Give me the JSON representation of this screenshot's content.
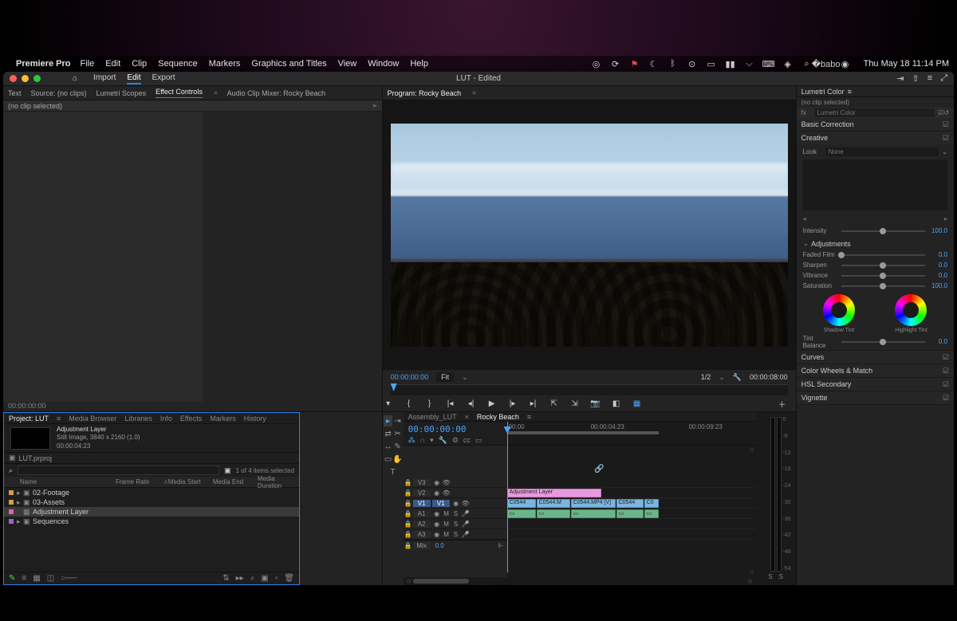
{
  "menubar": {
    "app": "Premiere Pro",
    "items": [
      "File",
      "Edit",
      "Clip",
      "Sequence",
      "Markers",
      "Graphics and Titles",
      "View",
      "Window",
      "Help"
    ],
    "datetime": "Thu May 18  11:14 PM"
  },
  "titlebar": {
    "modes": {
      "import": "Import",
      "edit": "Edit",
      "export": "Export"
    },
    "title": "LUT - Edited"
  },
  "source_tabs": {
    "text": "Text",
    "source": "Source: (no clips)",
    "lumetri_scopes": "Lumetri Scopes",
    "effect_controls": "Effect Controls",
    "audio_mixer": "Audio Clip Mixer: Rocky Beach"
  },
  "effect_controls": {
    "no_clip": "(no clip selected)",
    "timecode": "00:00:00:00"
  },
  "program": {
    "tab": "Program: Rocky Beach",
    "timecode": "00:00:00:00",
    "fit": "Fit",
    "resolution": "1/2",
    "duration": "00:00:08:00"
  },
  "project": {
    "tabs": {
      "project": "Project: LUT",
      "media": "Media Browser",
      "libraries": "Libraries",
      "info": "Info",
      "effects": "Effects",
      "markers": "Markers",
      "history": "History"
    },
    "selected_preview": {
      "name": "Adjustment Layer",
      "meta": "Still Image, 3840 x 2160 (1.0)",
      "dur": "00:00:04:23"
    },
    "bin": "LUT.prproj",
    "count": "1 of 4 items selected",
    "headers": {
      "name": "Name",
      "framerate": "Frame Rate",
      "mediastart": "Media Start",
      "mediaend": "Media End",
      "mediaduration": "Media Duration"
    },
    "rows": [
      {
        "name": "02-Footage",
        "type": "bin",
        "swatch": "orange"
      },
      {
        "name": "03-Assets",
        "type": "bin",
        "swatch": "orange"
      },
      {
        "name": "Adjustment Layer",
        "type": "item",
        "swatch": "pink",
        "selected": true
      },
      {
        "name": "Sequences",
        "type": "bin",
        "swatch": "violet"
      }
    ]
  },
  "timeline": {
    "tabs": {
      "assembly": "Assembly_LUT",
      "rocky": "Rocky Beach"
    },
    "timecode": "00:00:00:00",
    "ticks": [
      "00:00",
      "00:00:04:23",
      "00:00:09:23"
    ],
    "video_tracks": [
      "V3",
      "V2",
      "V1"
    ],
    "audio_tracks": [
      "A1",
      "A2",
      "A3"
    ],
    "mix": {
      "label": "Mix",
      "value": "0.0"
    },
    "clips": {
      "adjustment": "Adjustment Layer",
      "v1": [
        "C0544",
        "C0544.M",
        "C0544.MP4 [V]",
        "C0544",
        "C0"
      ]
    }
  },
  "audio_meters": {
    "scale": [
      "0",
      "-6",
      "-12",
      "-18",
      "-24",
      "-30",
      "-36",
      "-42",
      "-48",
      "-54"
    ],
    "solo": [
      "S",
      "S"
    ]
  },
  "lumetri": {
    "title": "Lumetri Color",
    "no_clip": "(no clip selected)",
    "fx_name": "Lumetri Color",
    "sections": {
      "basic": "Basic Correction",
      "creative": "Creative",
      "curves": "Curves",
      "wheels": "Color Wheels & Match",
      "hsl": "HSL Secondary",
      "vignette": "Vignette"
    },
    "creative": {
      "look_lbl": "Look",
      "look_val": "None",
      "intensity": {
        "lbl": "Intensity",
        "val": "100.0"
      },
      "adjustments": "Adjustments",
      "faded": {
        "lbl": "Faded Film",
        "val": "0.0"
      },
      "sharpen": {
        "lbl": "Sharpen",
        "val": "0.0"
      },
      "vibrance": {
        "lbl": "Vibrance",
        "val": "0.0"
      },
      "saturation": {
        "lbl": "Saturation",
        "val": "100.0"
      },
      "shadow_tint": "Shadow Tint",
      "highlight_tint": "Highlight Tint",
      "tint_balance": {
        "lbl": "Tint Balance",
        "val": "0.0"
      }
    }
  }
}
